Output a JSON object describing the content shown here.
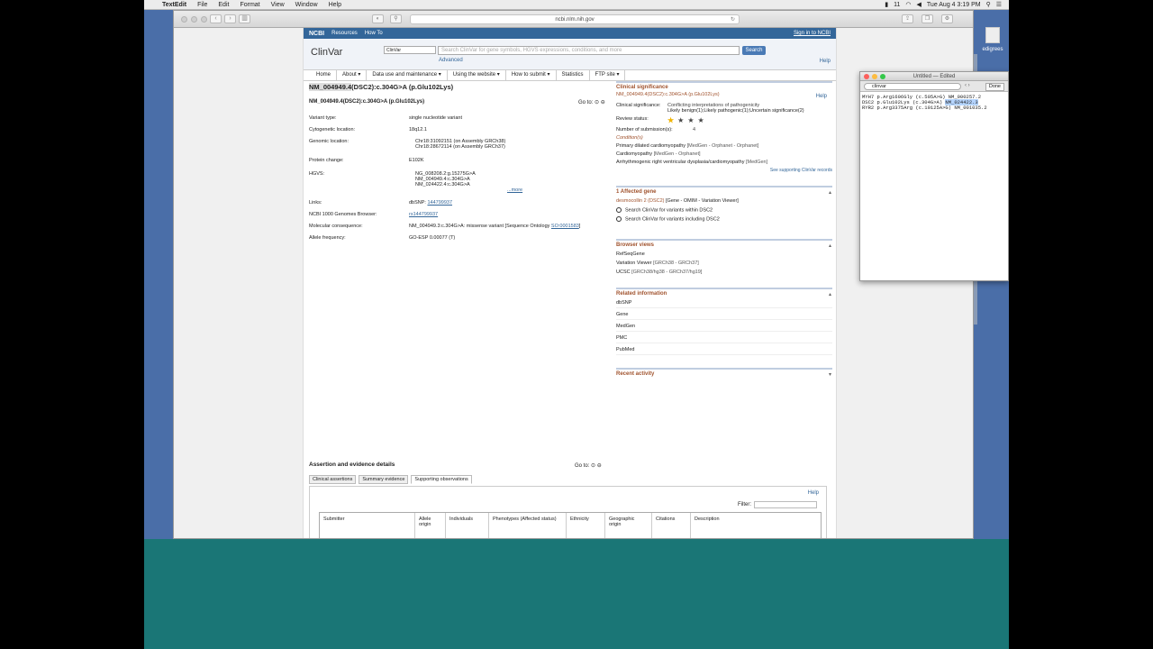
{
  "menubar": {
    "app": "TextEdit",
    "items": [
      "File",
      "Edit",
      "Format",
      "View",
      "Window",
      "Help"
    ],
    "clock": "Tue Aug 4  3:19 PM",
    "battery": "11"
  },
  "browser": {
    "url": "ncbi.nlm.nih.gov"
  },
  "ncbi": {
    "logo": "NCBI",
    "resources": "Resources",
    "howto": "How To",
    "signin": "Sign in to NCBI"
  },
  "clinvar": {
    "title": "ClinVar",
    "db": "ClinVar",
    "placeholder": "Search ClinVar for gene symbols, HGVS expressions, conditions, and more",
    "search": "Search",
    "advanced": "Advanced",
    "help": "Help"
  },
  "nav": [
    "Home",
    "About ▾",
    "Data use and maintenance ▾",
    "Using the website ▾",
    "How to submit ▾",
    "Statistics",
    "FTP site ▾"
  ],
  "variant": {
    "title_hl": "NM_004949.4",
    "title_rest": "(DSC2):c.304G>A (p.Glu102Lys)",
    "subtitle": "NM_004949.4(DSC2):c.304G>A (p.Glu102Lys)",
    "goto": "Go to:",
    "type_k": "Variant type:",
    "type_v": "single nucleotide variant",
    "cyto_k": "Cytogenetic location:",
    "cyto_v": "18q12.1",
    "gloc_k": "Genomic location:",
    "gloc_v1": "Chr18:31092151 (on Assembly GRCh38)",
    "gloc_v2": "Chr18:28672114 (on Assembly GRCh37)",
    "prot_k": "Protein change:",
    "prot_v": "E102K",
    "hgvs_k": "HGVS:",
    "hgvs1": "NG_008208.2:g.15275G>A",
    "hgvs2": "NM_004949.4:c.304G>A",
    "hgvs3": "NM_024422.4:c.304G>A",
    "more": "...more",
    "links_k": "Links:",
    "links_pre": "dbSNP: ",
    "links_v": "144799937",
    "g1000_k": "NCBI 1000 Genomes Browser:",
    "g1000_v": "rs144799937",
    "mc_k": "Molecular consequence:",
    "mc_v1": "NM_004949.3:c.304G>A: missense variant [Sequence Ontology ",
    "mc_so": "SO:0001583",
    "mc_end": "]",
    "af_k": "Allele frequency:",
    "af_v": "GO-ESP 0.00077 (T)"
  },
  "clinsig": {
    "title": "Clinical significance",
    "variant": "NM_004949.4(DSC2):c.304G>A (p.Glu102Lys)",
    "help": "Help",
    "sig_k": "Clinical significance:",
    "sig_v": "Conflicting interpretations of pathogenicity",
    "sig_d1": "Likely benign(1);Likely pathogenic(1);Uncertain significance(2)",
    "review_k": "Review status:",
    "num_k": "Number of submission(s):",
    "num_v": "4",
    "cond_label": "Condition(s)",
    "c1": "Primary dilated cardiomyopathy",
    "c1s": "[MedGen - Orphanet - Orphanet]",
    "c2": "Cardiomyopathy",
    "c2s": "[MedGen - Orphanet]",
    "c3": "Arrhythmogenic right ventricular dysplasia/cardiomyopathy",
    "c3s": "[MedGen]",
    "see": "See supporting ClinVar records"
  },
  "gene": {
    "title": "1 Affected gene",
    "name": "desmocollin 2 (DSC2)",
    "links": "[Gene - OMIM - Variation Viewer]",
    "s1": "Search ClinVar for variants within DSC2",
    "s2": "Search ClinVar for variants including DSC2"
  },
  "browser_views": {
    "title": "Browser views",
    "r1": "RefSeqGene",
    "r2": "Variation Viewer",
    "r2s": "[GRCh38 - GRCh37]",
    "r3": "UCSC",
    "r3s": "[GRCh38/hg38 - GRCh37/hg19]"
  },
  "related": {
    "title": "Related information",
    "items": [
      "dbSNP",
      "Gene",
      "MedGen",
      "PMC",
      "PubMed"
    ]
  },
  "recent": {
    "title": "Recent activity"
  },
  "assert": {
    "title": "Assertion and evidence details",
    "goto": "Go to:",
    "tabs": [
      "Clinical assertions",
      "Summary evidence",
      "Supporting observations"
    ],
    "help": "Help",
    "filter": "Filter:",
    "cols": [
      "Submitter",
      "Allele origin",
      "Individuals",
      "Phenotypes (Affected status)",
      "Ethnicity",
      "Geographic origin",
      "Citations",
      "Description"
    ]
  },
  "textedit": {
    "title": "Untitled — Edited",
    "find": "clinvar",
    "done": "Done",
    "l1": "MYH7 p.Arg1606Gly (c.505A>G) NM_000257.2",
    "l2a": "DSC2 p.Glu102Lys (c.304G>A) ",
    "l2b": "NM_024422.3",
    "l3": "RYR2 p.Arg3375Arg (c.10125A>G) NM_001035.2"
  },
  "desktop": {
    "pedigree": "edigrees"
  }
}
